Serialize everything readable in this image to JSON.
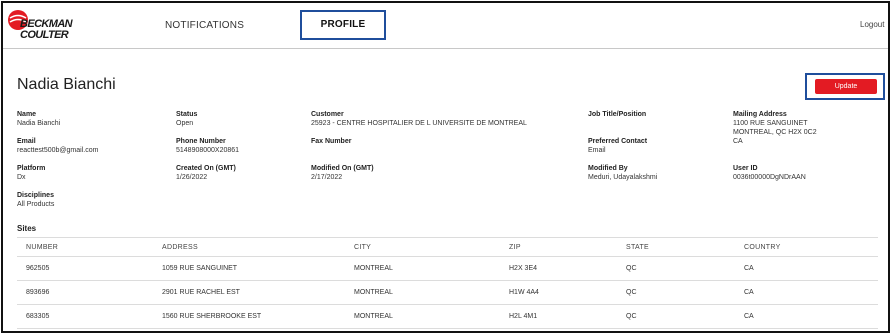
{
  "brand": {
    "line1": "BECKMAN",
    "line2": "COULTER",
    "color": "#e31b23"
  },
  "nav": {
    "notifications": "NOTIFICATIONS",
    "profile": "PROFILE",
    "logout": "Logout"
  },
  "page": {
    "title": "Nadia Bianchi",
    "update_label": "Update"
  },
  "fields": {
    "name": {
      "label": "Name",
      "value": "Nadia Bianchi"
    },
    "status": {
      "label": "Status",
      "value": "Open"
    },
    "customer": {
      "label": "Customer",
      "value": "25923 - CENTRE HOSPITALIER DE L UNIVERSITE DE MONTREAL"
    },
    "job_title": {
      "label": "Job Title/Position",
      "value": ""
    },
    "mailing_address": {
      "label": "Mailing Address",
      "line1": "1100 RUE SANGUINET",
      "line2": "MONTREAL, QC H2X 0C2",
      "line3": "CA"
    },
    "email": {
      "label": "Email",
      "value": "reacttest500b@gmail.com"
    },
    "phone": {
      "label": "Phone Number",
      "value": "5148908000X20861"
    },
    "fax": {
      "label": "Fax Number",
      "value": ""
    },
    "preferred_contact": {
      "label": "Preferred Contact",
      "value": "Email"
    },
    "platform": {
      "label": "Platform",
      "value": "Dx"
    },
    "created_on": {
      "label": "Created On (GMT)",
      "value": "1/26/2022"
    },
    "modified_on": {
      "label": "Modified On (GMT)",
      "value": "2/17/2022"
    },
    "modified_by": {
      "label": "Modified By",
      "value": "Meduri, Udayalakshmi"
    },
    "user_id": {
      "label": "User ID",
      "value": "0036t00000DgNDrAAN"
    },
    "disciplines": {
      "label": "Disciplines",
      "value": "All Products"
    }
  },
  "sites": {
    "title": "Sites",
    "columns": [
      "NUMBER",
      "ADDRESS",
      "CITY",
      "ZIP",
      "STATE",
      "COUNTRY"
    ],
    "rows": [
      [
        "962505",
        "1059 RUE SANGUINET",
        "MONTREAL",
        "H2X 3E4",
        "QC",
        "CA"
      ],
      [
        "893696",
        "2901 RUE RACHEL EST",
        "MONTREAL",
        "H1W 4A4",
        "QC",
        "CA"
      ],
      [
        "683305",
        "1560 RUE SHERBROOKE EST",
        "MONTREAL",
        "H2L 4M1",
        "QC",
        "CA"
      ]
    ]
  },
  "colors": {
    "accent_outline": "#1f4e9c",
    "button_red": "#e31b23"
  }
}
